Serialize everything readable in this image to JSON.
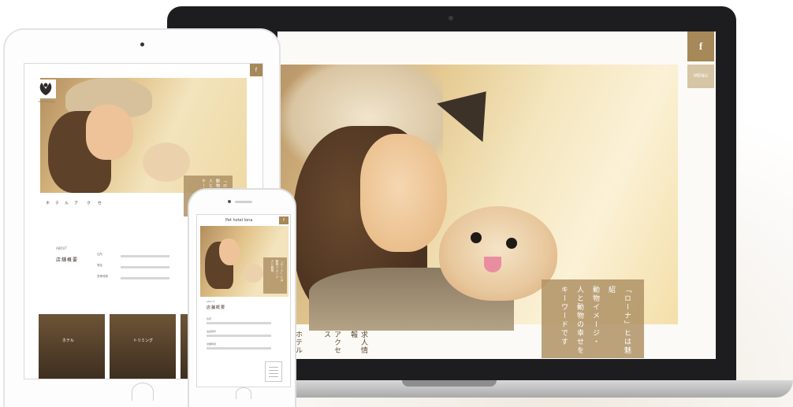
{
  "laptop": {
    "social_icon": "f",
    "menu_label": "MENU",
    "tagline": [
      "「ローナ」ヒは魅紹",
      "動物イメージ・",
      "人と動物の幸せを",
      "キーワードです"
    ],
    "nav": [
      "ホテル",
      "アクセス",
      "求人情報"
    ]
  },
  "tablet": {
    "social_icon": "f",
    "logo_text": "Pet hotel lona",
    "tagline": [
      "「ローナ」とは",
      "動物イメージ",
      "人と動物の幸せ",
      "キーワード"
    ],
    "nav": [
      "ホ",
      "テ",
      "ル",
      "ア",
      "ク",
      "セ"
    ],
    "section_label": "ABOUT",
    "section_title": "店舗概要",
    "info_rows": [
      {
        "label": "住所"
      },
      {
        "label": "電話"
      },
      {
        "label": "営業時間"
      }
    ],
    "photos": [
      {
        "caption": "ホテル"
      },
      {
        "caption": "トリミング"
      },
      {
        "caption": ""
      }
    ]
  },
  "phone": {
    "logo_text": "Pet hotel lona",
    "social_icon": "f",
    "tagline": [
      "「ローナ」とは",
      "動物イメージ",
      "人と動物"
    ],
    "section_label": "ABOUT",
    "section_title": "店舗概要",
    "fields": [
      "住所",
      "電話番号",
      "営業時間"
    ]
  },
  "colors": {
    "accent": "#a68859",
    "accent_light": "#d6c6a6",
    "bezel": "#1d1d1f"
  }
}
